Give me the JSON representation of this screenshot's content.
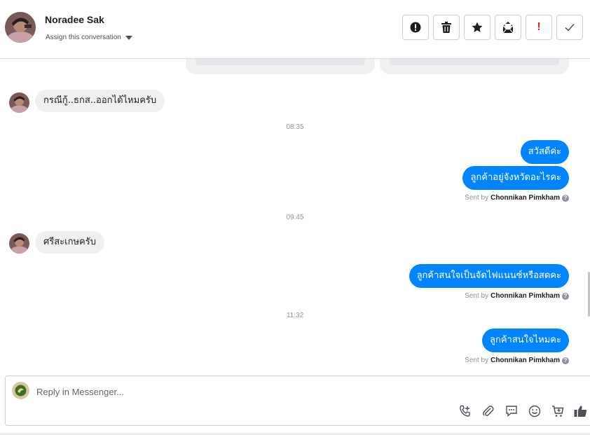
{
  "header": {
    "contact_name": "Noradee Sak",
    "assign_label": "Assign this conversation",
    "actions": [
      {
        "icon": "alert-circle-icon",
        "label": "!"
      },
      {
        "icon": "trash-icon"
      },
      {
        "icon": "star-icon"
      },
      {
        "icon": "mark-unread-icon"
      },
      {
        "icon": "exclamation-icon",
        "label": "!"
      },
      {
        "icon": "check-icon"
      }
    ]
  },
  "thread": {
    "messages": [
      {
        "direction": "in",
        "text": "กรณีกู้..ธกส..ออกได้ไหมครับ"
      },
      {
        "type": "timestamp",
        "text": "08:35"
      },
      {
        "direction": "out",
        "text": "สวัสดีค่ะ"
      },
      {
        "direction": "out",
        "text": "ลูกค้าอยู่จังหวัดอะไรคะ"
      },
      {
        "type": "sent_by",
        "prefix": "Sent by",
        "agent": "Chonnikan Pimkham"
      },
      {
        "type": "timestamp",
        "text": "09:45"
      },
      {
        "direction": "in",
        "text": "ศรีสะเกษครับ"
      },
      {
        "direction": "out",
        "text": "ลูกค้าสนใจเป็นจัดไฟแนนซ์หรือสดคะ"
      },
      {
        "type": "sent_by",
        "prefix": "Sent by",
        "agent": "Chonnikan Pimkham"
      },
      {
        "type": "timestamp",
        "text": "11:32"
      },
      {
        "direction": "out",
        "text": "ลูกค้าสนใจไหมคะ"
      },
      {
        "type": "sent_by",
        "prefix": "Sent by",
        "agent": "Chonnikan Pimkham"
      }
    ]
  },
  "composer": {
    "placeholder": "Reply in Messenger...",
    "value": "",
    "tools": [
      "call-add-icon",
      "attachment-icon",
      "saved-reply-icon",
      "emoji-icon",
      "add-to-cart-icon",
      "thumbs-up-icon"
    ]
  },
  "colors": {
    "outgoing_bubble": "#0084ff",
    "incoming_bubble": "#f0f0f0",
    "alert_red": "#e02020"
  }
}
